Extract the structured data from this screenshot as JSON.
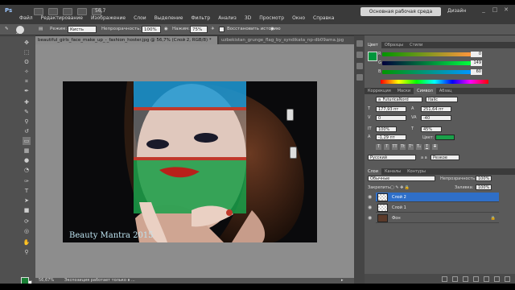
{
  "app": {
    "logo": "Ps",
    "zoom": "56,7",
    "workspace_button": "Основная рабочая среда",
    "workspace_label": "Дизайн",
    "menu": [
      "Файл",
      "Редактирование",
      "Изображение",
      "Слои",
      "Выделение",
      "Фильтр",
      "Анализ",
      "3D",
      "Просмотр",
      "Окно",
      "Справка"
    ]
  },
  "options_bar": {
    "mode_label": "Режим:",
    "mode_value": "Кисть",
    "opacity_label": "Непрозрачность:",
    "opacity_value": "100%",
    "pressure_label": "Нажим:",
    "pressure_value": "75%",
    "history_label": "Восстановить историю",
    "brush_size": "200"
  },
  "document_tabs": [
    {
      "label": "beautiful_girls_face_make_up_-_fashion_hoster.jpg @ 56,7% (Слой 2, RGB/8) *",
      "active": true
    },
    {
      "label": "uzbekistan_grunge_flag_by_syndikata_np-db09ama.jpg",
      "active": false
    }
  ],
  "canvas": {
    "watermark": "Beauty Mantra 2015",
    "flag_colors": {
      "blue": "#1e9bd8",
      "white": "#f2f2f2",
      "red": "#c0392b",
      "green": "#1aa04a"
    }
  },
  "status_bar": {
    "zoom": "56,67%",
    "message": "Экспозиция работает только в ..."
  },
  "color_panel": {
    "tabs": [
      "Цвет",
      "Образцы",
      "Стили"
    ],
    "r": "0",
    "g": "149",
    "b": "60",
    "fg_color": "#00953c"
  },
  "character_panel": {
    "tabs": [
      "Коррекция",
      "Маски",
      "Символ",
      "Абзац"
    ],
    "font_family": "a_FuturicaNord",
    "font_style": "Italic",
    "font_size": "177,93 пт",
    "leading": "251,64 пт",
    "kerning": "0",
    "tracking": "-40",
    "vertical_scale": "100%",
    "horizontal_scale": "45%",
    "baseline": "-1,29 пт",
    "color_label": "Цвет:",
    "text_color": "#1aa04a",
    "language": "Русский",
    "antialias": "Резкое",
    "aa_label": "a a"
  },
  "layers_panel": {
    "tabs": [
      "Слои",
      "Каналы",
      "Контуры"
    ],
    "blend_mode": "Обычные",
    "opacity_label": "Непрозрачность:",
    "opacity_value": "100%",
    "lock_label": "Закрепить:",
    "fill_label": "Заливка:",
    "fill_value": "100%",
    "layers": [
      {
        "name": "Слой 2",
        "selected": true
      },
      {
        "name": "Слой 1",
        "selected": false
      },
      {
        "name": "Фон",
        "selected": false
      }
    ]
  },
  "tool_icons": [
    "move-tool-icon",
    "marquee-tool-icon",
    "lasso-tool-icon",
    "quick-select-tool-icon",
    "crop-tool-icon",
    "eyedropper-tool-icon",
    "healing-tool-icon",
    "brush-tool-icon",
    "clone-stamp-tool-icon",
    "history-brush-tool-icon",
    "eraser-tool-icon",
    "gradient-tool-icon",
    "blur-tool-icon",
    "dodge-tool-icon",
    "pen-tool-icon",
    "type-tool-icon",
    "path-select-tool-icon",
    "shape-tool-icon",
    "3d-rotate-tool-icon",
    "3d-camera-tool-icon",
    "hand-tool-icon",
    "zoom-tool-icon"
  ]
}
